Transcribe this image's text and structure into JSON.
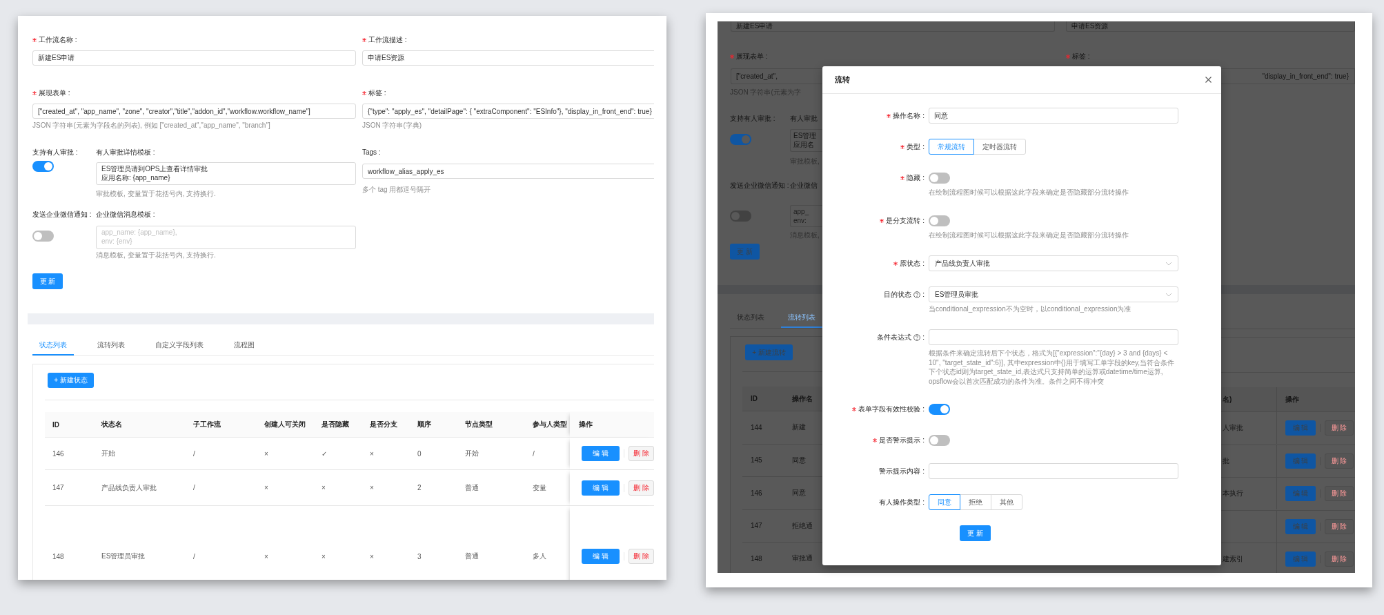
{
  "left_page": {
    "fields": [
      {
        "label": "工作流名称 :",
        "required": true,
        "value": "新建ES申请"
      },
      {
        "label": "工作流描述 :",
        "required": true,
        "value": "申请ES资源"
      },
      {
        "label": "展现表单 :",
        "required": true,
        "value": "[\"created_at\", \"app_name\", \"zone\", \"creator\",\"title\",\"addon_id\",\"workflow.workflow_name\"]",
        "hint": "JSON 字符串(元素为字段名的列表), 例如 [\"created_at\",\"app_name\", \"branch\"]"
      },
      {
        "label": "标签 :",
        "required": true,
        "value": "{\"type\": \"apply_es\", \"detailPage\": { \"extraComponent\": \"ESInfo\"}, \"display_in_front_end\": true}",
        "hint": "JSON 字符串(字典)"
      }
    ],
    "approval": {
      "label": "支持有人审批 :",
      "on": true,
      "template_label": "有人审批详情模板 :",
      "template_lines": [
        "ES管理员请到OPS上查看详情审批",
        "应用名称: {app_name}"
      ],
      "hint": "审批模板, 变量置于花括号内, 支持换行."
    },
    "tags": {
      "label": "Tags :",
      "value": "workflow_alias_apply_es",
      "hint": "多个 tag 用都逗号隔开"
    },
    "wechat": {
      "label": "发送企业微信通知 :",
      "on": false,
      "template_label": "企业微信消息模板 :",
      "placeholder": "app_name: {app_name},\nenv: {env}",
      "hint": "消息模板, 变量置于花括号内, 支持换行."
    },
    "update_button": "更 新",
    "tabs": [
      {
        "label": "状态列表",
        "selected": true
      },
      {
        "label": "流转列表",
        "selected": false
      },
      {
        "label": "自定义字段列表",
        "selected": false
      },
      {
        "label": "流程图",
        "selected": false
      }
    ],
    "new_button": "+ 新建状态",
    "table": {
      "columns": [
        "ID",
        "状态名",
        "子工作流",
        "创建人可关闭",
        "是否隐藏",
        "是否分支",
        "顺序",
        "节点类型",
        "参与人类型",
        "操作"
      ],
      "rows": [
        {
          "cells": [
            "146",
            "开始",
            "/",
            "×",
            "✓",
            "×",
            "0",
            "开始",
            "/"
          ],
          "edit": "编 辑",
          "delete": "删 除"
        },
        {
          "cells": [
            "147",
            "产品线负责人审批",
            "/",
            "×",
            "×",
            "×",
            "2",
            "普通",
            "变量"
          ],
          "edit": "编 辑",
          "delete": "删 除"
        },
        {
          "cells": [
            "148",
            "ES管理员审批",
            "/",
            "×",
            "×",
            "×",
            "3",
            "普通",
            "多人"
          ],
          "edit": "编 辑",
          "delete": "删 除"
        }
      ]
    }
  },
  "dimmed_page": {
    "top_fields": [
      "新建ES申请",
      "申请ES资源"
    ],
    "top_labels": [
      {
        "text": "展现表单 :",
        "required": true
      },
      {
        "text": "标签 :",
        "required": true
      }
    ],
    "form_field_start": "[\"created_at\",",
    "form_field_end": "\"display_in_front_end\": true}",
    "form_hint": "JSON 字符串(元素为字",
    "approval": {
      "label": "支持有人审批 :",
      "on": true,
      "template_label": "有人审批",
      "template_lines": [
        "ES管理",
        "应用名"
      ],
      "hint": "审批模板,"
    },
    "wechat": {
      "label": "发送企业微信通知 :",
      "on": false,
      "template_label": "企业微信",
      "placeholder": "app_\nenv:",
      "hint": "消息模板,"
    },
    "update_button": "更 新",
    "tabs": [
      {
        "label": "状态列表",
        "selected": false
      },
      {
        "label": "流转列表",
        "selected": true
      }
    ],
    "new_button": "+ 新建流转",
    "table": {
      "columns_left": [
        "ID",
        "操作名"
      ],
      "columns_right": [
        "名)",
        "操作"
      ],
      "rows": [
        {
          "id": "144",
          "name": "新建",
          "tail": "人审批",
          "edit": "编 辑",
          "delete": "删 除"
        },
        {
          "id": "145",
          "name": "同意",
          "tail": "批",
          "edit": "编 辑",
          "delete": "删 除"
        },
        {
          "id": "146",
          "name": "同意",
          "tail": "本执行",
          "edit": "编 辑",
          "delete": "删 除"
        },
        {
          "id": "147",
          "name": "拒绝通",
          "edit": "编 辑",
          "delete": "删 除"
        },
        {
          "id": "148",
          "name": "审批通",
          "tail": "建索引",
          "edit": "编 辑",
          "delete": "删 除"
        }
      ]
    }
  },
  "modal": {
    "title": "流转",
    "rows": [
      {
        "kind": "input",
        "label": "操作名称 :",
        "required": true,
        "value": "同意"
      },
      {
        "kind": "segmented",
        "label": "类型 :",
        "required": true,
        "options": [
          {
            "label": "常规流转",
            "selected": true
          },
          {
            "label": "定时器流转",
            "selected": false
          }
        ]
      },
      {
        "kind": "switch",
        "label": "隐藏 :",
        "required": true,
        "on": false,
        "hint": "在绘制流程图时候可以根据这此字段来确定是否隐藏部分流转操作"
      },
      {
        "kind": "switch",
        "label": "是分支流转 :",
        "required": true,
        "on": false,
        "hint": "在绘制流程图时候可以根据这此字段来确定是否隐藏部分流转操作"
      },
      {
        "kind": "select",
        "label": "原状态 :",
        "required": true,
        "value": "产品线负责人审批"
      },
      {
        "kind": "select",
        "label": "目的状态",
        "help": true,
        "label_end": ":",
        "required": false,
        "value": "ES管理员审批",
        "hint": "当conditional_expression不为空时，以conditional_expression为准"
      },
      {
        "kind": "input",
        "label": "条件表达式",
        "help": true,
        "label_end": ":",
        "required": false,
        "hint": "根据条件来确定流转后下个状态，格式为[{\"expression\":\"{day} > 3 and {days} < 10\", \"target_state_id\":6}], 其中expression中{}用于填写工单字段的key,当符合条件下个状态id则为target_state_id,表达式只支持简单的运算或datetime/time运算, opsflow会以首次匹配成功的条件为准。条件之间不得冲突"
      },
      {
        "kind": "switch",
        "label": "表单字段有效性校验 :",
        "required": true,
        "on": true
      },
      {
        "kind": "switch",
        "label": "是否警示提示 :",
        "required": true,
        "on": false
      },
      {
        "kind": "input",
        "label": "警示提示内容 :",
        "required": false
      },
      {
        "kind": "segmented",
        "label": "有人操作类型 :",
        "required": false,
        "options": [
          {
            "label": "同意",
            "selected": true
          },
          {
            "label": "拒绝",
            "selected": false
          },
          {
            "label": "其他",
            "selected": false
          }
        ]
      }
    ],
    "submit": "更 新"
  }
}
